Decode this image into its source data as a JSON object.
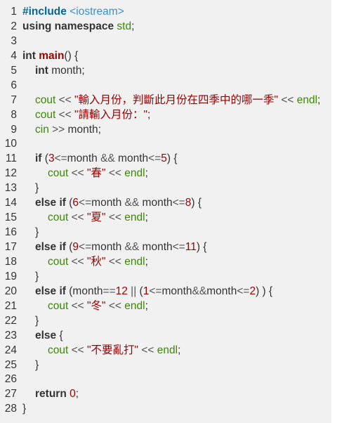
{
  "code": {
    "lines": [
      {
        "n": "1",
        "indent": 0,
        "tokens": [
          {
            "t": "pp",
            "v": "#include"
          },
          {
            "t": "plain",
            "v": " "
          },
          {
            "t": "ppf",
            "v": "<iostream>"
          }
        ]
      },
      {
        "n": "2",
        "indent": 0,
        "tokens": [
          {
            "t": "kw",
            "v": "using"
          },
          {
            "t": "plain",
            "v": " "
          },
          {
            "t": "kw",
            "v": "namespace"
          },
          {
            "t": "plain",
            "v": " "
          },
          {
            "t": "id",
            "v": "std"
          },
          {
            "t": "plain",
            "v": ";"
          }
        ]
      },
      {
        "n": "3",
        "indent": 0,
        "tokens": []
      },
      {
        "n": "4",
        "indent": 0,
        "tokens": [
          {
            "t": "kw",
            "v": "int"
          },
          {
            "t": "plain",
            "v": " "
          },
          {
            "t": "fn",
            "v": "main"
          },
          {
            "t": "plain",
            "v": "() {"
          }
        ]
      },
      {
        "n": "5",
        "indent": 1,
        "tokens": [
          {
            "t": "kw",
            "v": "int"
          },
          {
            "t": "plain",
            "v": " month;"
          }
        ]
      },
      {
        "n": "6",
        "indent": 0,
        "tokens": []
      },
      {
        "n": "7",
        "indent": 1,
        "tokens": [
          {
            "t": "id",
            "v": "cout"
          },
          {
            "t": "op",
            "v": " << "
          },
          {
            "t": "str",
            "v": "\"輸入月份，判斷此月份在四季中的哪一季\""
          },
          {
            "t": "op",
            "v": " << "
          },
          {
            "t": "id",
            "v": "endl"
          },
          {
            "t": "plain",
            "v": ";"
          }
        ]
      },
      {
        "n": "8",
        "indent": 1,
        "tokens": [
          {
            "t": "id",
            "v": "cout"
          },
          {
            "t": "op",
            "v": " << "
          },
          {
            "t": "str",
            "v": "\"請輸入月份：\""
          },
          {
            "t": "plain",
            "v": ";"
          }
        ]
      },
      {
        "n": "9",
        "indent": 1,
        "tokens": [
          {
            "t": "id",
            "v": "cin"
          },
          {
            "t": "op",
            "v": " >> "
          },
          {
            "t": "plain",
            "v": "month;"
          }
        ]
      },
      {
        "n": "10",
        "indent": 0,
        "tokens": []
      },
      {
        "n": "11",
        "indent": 1,
        "tokens": [
          {
            "t": "kw",
            "v": "if"
          },
          {
            "t": "plain",
            "v": " ("
          },
          {
            "t": "num",
            "v": "3"
          },
          {
            "t": "op",
            "v": "<="
          },
          {
            "t": "plain",
            "v": "month "
          },
          {
            "t": "op",
            "v": "&&"
          },
          {
            "t": "plain",
            "v": " month"
          },
          {
            "t": "op",
            "v": "<="
          },
          {
            "t": "num",
            "v": "5"
          },
          {
            "t": "plain",
            "v": ") {"
          }
        ]
      },
      {
        "n": "12",
        "indent": 2,
        "tokens": [
          {
            "t": "id",
            "v": "cout"
          },
          {
            "t": "op",
            "v": " << "
          },
          {
            "t": "str",
            "v": "\"春\""
          },
          {
            "t": "op",
            "v": " << "
          },
          {
            "t": "id",
            "v": "endl"
          },
          {
            "t": "plain",
            "v": ";"
          }
        ]
      },
      {
        "n": "13",
        "indent": 1,
        "tokens": [
          {
            "t": "plain",
            "v": "}"
          }
        ]
      },
      {
        "n": "14",
        "indent": 1,
        "tokens": [
          {
            "t": "kw",
            "v": "else"
          },
          {
            "t": "plain",
            "v": " "
          },
          {
            "t": "kw",
            "v": "if"
          },
          {
            "t": "plain",
            "v": " ("
          },
          {
            "t": "num",
            "v": "6"
          },
          {
            "t": "op",
            "v": "<="
          },
          {
            "t": "plain",
            "v": "month "
          },
          {
            "t": "op",
            "v": "&&"
          },
          {
            "t": "plain",
            "v": " month"
          },
          {
            "t": "op",
            "v": "<="
          },
          {
            "t": "num",
            "v": "8"
          },
          {
            "t": "plain",
            "v": ") {"
          }
        ]
      },
      {
        "n": "15",
        "indent": 2,
        "tokens": [
          {
            "t": "id",
            "v": "cout"
          },
          {
            "t": "op",
            "v": " << "
          },
          {
            "t": "str",
            "v": "\"夏\""
          },
          {
            "t": "op",
            "v": " << "
          },
          {
            "t": "id",
            "v": "endl"
          },
          {
            "t": "plain",
            "v": ";"
          }
        ]
      },
      {
        "n": "16",
        "indent": 1,
        "tokens": [
          {
            "t": "plain",
            "v": "}"
          }
        ]
      },
      {
        "n": "17",
        "indent": 1,
        "tokens": [
          {
            "t": "kw",
            "v": "else"
          },
          {
            "t": "plain",
            "v": " "
          },
          {
            "t": "kw",
            "v": "if"
          },
          {
            "t": "plain",
            "v": " ("
          },
          {
            "t": "num",
            "v": "9"
          },
          {
            "t": "op",
            "v": "<="
          },
          {
            "t": "plain",
            "v": "month "
          },
          {
            "t": "op",
            "v": "&&"
          },
          {
            "t": "plain",
            "v": " month"
          },
          {
            "t": "op",
            "v": "<="
          },
          {
            "t": "num",
            "v": "11"
          },
          {
            "t": "plain",
            "v": ") {"
          }
        ]
      },
      {
        "n": "18",
        "indent": 2,
        "tokens": [
          {
            "t": "id",
            "v": "cout"
          },
          {
            "t": "op",
            "v": " << "
          },
          {
            "t": "str",
            "v": "\"秋\""
          },
          {
            "t": "op",
            "v": " << "
          },
          {
            "t": "id",
            "v": "endl"
          },
          {
            "t": "plain",
            "v": ";"
          }
        ]
      },
      {
        "n": "19",
        "indent": 1,
        "tokens": [
          {
            "t": "plain",
            "v": "}"
          }
        ]
      },
      {
        "n": "20",
        "indent": 1,
        "tokens": [
          {
            "t": "kw",
            "v": "else"
          },
          {
            "t": "plain",
            "v": " "
          },
          {
            "t": "kw",
            "v": "if"
          },
          {
            "t": "plain",
            "v": " (month"
          },
          {
            "t": "op",
            "v": "=="
          },
          {
            "t": "num",
            "v": "12"
          },
          {
            "t": "op",
            "v": " || "
          },
          {
            "t": "plain",
            "v": "("
          },
          {
            "t": "num",
            "v": "1"
          },
          {
            "t": "op",
            "v": "<="
          },
          {
            "t": "plain",
            "v": "month"
          },
          {
            "t": "op",
            "v": "&&"
          },
          {
            "t": "plain",
            "v": "month"
          },
          {
            "t": "op",
            "v": "<="
          },
          {
            "t": "num",
            "v": "2"
          },
          {
            "t": "plain",
            "v": ") ) {"
          }
        ]
      },
      {
        "n": "21",
        "indent": 2,
        "tokens": [
          {
            "t": "id",
            "v": "cout"
          },
          {
            "t": "op",
            "v": " << "
          },
          {
            "t": "str",
            "v": "\"冬\""
          },
          {
            "t": "op",
            "v": " << "
          },
          {
            "t": "id",
            "v": "endl"
          },
          {
            "t": "plain",
            "v": ";"
          }
        ]
      },
      {
        "n": "22",
        "indent": 1,
        "tokens": [
          {
            "t": "plain",
            "v": "}"
          }
        ]
      },
      {
        "n": "23",
        "indent": 1,
        "tokens": [
          {
            "t": "kw",
            "v": "else"
          },
          {
            "t": "plain",
            "v": " {"
          }
        ]
      },
      {
        "n": "24",
        "indent": 2,
        "tokens": [
          {
            "t": "id",
            "v": "cout"
          },
          {
            "t": "op",
            "v": " << "
          },
          {
            "t": "str",
            "v": "\"不要亂打\""
          },
          {
            "t": "op",
            "v": " << "
          },
          {
            "t": "id",
            "v": "endl"
          },
          {
            "t": "plain",
            "v": ";"
          }
        ]
      },
      {
        "n": "25",
        "indent": 1,
        "tokens": [
          {
            "t": "plain",
            "v": "}"
          }
        ]
      },
      {
        "n": "26",
        "indent": 0,
        "tokens": []
      },
      {
        "n": "27",
        "indent": 1,
        "tokens": [
          {
            "t": "kw",
            "v": "return"
          },
          {
            "t": "plain",
            "v": " "
          },
          {
            "t": "num",
            "v": "0"
          },
          {
            "t": "plain",
            "v": ";"
          }
        ]
      },
      {
        "n": "28",
        "indent": 0,
        "tokens": [
          {
            "t": "plain",
            "v": "}"
          }
        ]
      }
    ]
  },
  "colors": {
    "background": "#f1f1f1",
    "keyword": "#333333",
    "function": "#990000",
    "string": "#990000",
    "number": "#990000",
    "preprocessor": "#006699",
    "include_file": "#3d8fc9",
    "identifier": "#3a8a00"
  }
}
